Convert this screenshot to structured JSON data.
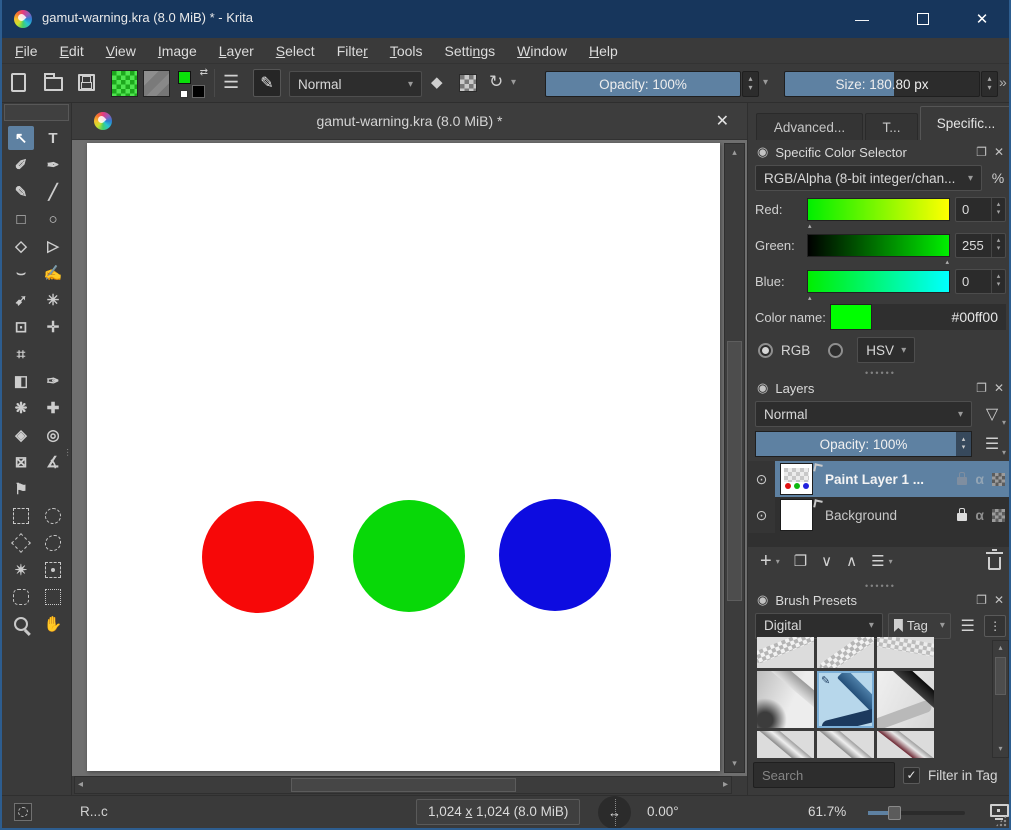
{
  "window": {
    "title": "gamut-warning.kra (8.0 MiB) * - Krita"
  },
  "icons": {
    "window_min": "—",
    "window_close": "✕",
    "docker_lock": "◉",
    "docker_float": "❐",
    "docker_close": "✕",
    "dropdown_arrow": "▾",
    "filter_funnel": "▽",
    "hamburger": "☰",
    "eye": "⊙",
    "swap": "⇄",
    "presets_list": "☰",
    "brush_editor": "✎",
    "eraser": "◆",
    "reload": "↻",
    "overflow_chevron": "»",
    "up_arrow": "▴",
    "down_arrow": "▾",
    "left_arrow": "◂",
    "right_arrow": "▸",
    "add": "+",
    "duplicate": "❐",
    "move_down": "∨",
    "move_up": "∧",
    "properties": "☰",
    "detail_dots": "⋮",
    "check": "✓",
    "percent": "%"
  },
  "menu": {
    "items": [
      {
        "name": "menu-file",
        "pre": "",
        "key": "F",
        "post": "ile"
      },
      {
        "name": "menu-edit",
        "pre": "",
        "key": "E",
        "post": "dit"
      },
      {
        "name": "menu-view",
        "pre": "",
        "key": "V",
        "post": "iew"
      },
      {
        "name": "menu-image",
        "pre": "",
        "key": "I",
        "post": "mage"
      },
      {
        "name": "menu-layer",
        "pre": "",
        "key": "L",
        "post": "ayer"
      },
      {
        "name": "menu-select",
        "pre": "",
        "key": "S",
        "post": "elect"
      },
      {
        "name": "menu-filter",
        "pre": "Filte",
        "key": "r",
        "post": ""
      },
      {
        "name": "menu-tools",
        "pre": "",
        "key": "T",
        "post": "ools"
      },
      {
        "name": "menu-settings",
        "pre": "Setti",
        "key": "n",
        "post": "gs"
      },
      {
        "name": "menu-window",
        "pre": "",
        "key": "W",
        "post": "indow"
      },
      {
        "name": "menu-help",
        "pre": "",
        "key": "H",
        "post": "elp"
      }
    ]
  },
  "toolbar": {
    "blending_mode": "Normal",
    "opacity": "Opacity: 100%",
    "size": "Size: 180.80 px",
    "size_fill_style": "width:56%",
    "fg_style": "background:#0ae00a"
  },
  "toolbox": {
    "tools": [
      {
        "name": "transform-select-tool",
        "g": "↖",
        "cls": "sel"
      },
      {
        "name": "text-tool",
        "g": "T",
        "cls": ""
      },
      {
        "name": "edit-shapes-tool",
        "g": "✐",
        "cls": ""
      },
      {
        "name": "calligraphy-tool",
        "g": "✒",
        "cls": ""
      },
      {
        "name": "freehand-brush-tool",
        "g": "✎",
        "cls": ""
      },
      {
        "name": "line-tool",
        "g": "╱",
        "cls": ""
      },
      {
        "name": "rectangle-tool",
        "g": "□",
        "cls": ""
      },
      {
        "name": "ellipse-tool",
        "g": "○",
        "cls": ""
      },
      {
        "name": "polygon-tool",
        "g": "◇",
        "cls": ""
      },
      {
        "name": "polyline-tool",
        "g": "▷",
        "cls": ""
      },
      {
        "name": "bezier-curve-tool",
        "g": "⌣",
        "cls": ""
      },
      {
        "name": "freehand-path-tool",
        "g": "✍",
        "cls": ""
      },
      {
        "name": "dynamic-brush-tool",
        "g": "➹",
        "cls": ""
      },
      {
        "name": "multibrush-tool",
        "g": "✳",
        "cls": ""
      },
      {
        "name": "transform-tool",
        "g": "⊡",
        "cls": ""
      },
      {
        "name": "move-tool",
        "g": "✛",
        "cls": ""
      },
      {
        "name": "crop-tool",
        "g": "⌗",
        "cls": ""
      },
      {
        "name": "",
        "g": "",
        "cls": "blank"
      },
      {
        "name": "gradient-tool",
        "g": "◧",
        "cls": ""
      },
      {
        "name": "color-sampler-tool",
        "g": "✑",
        "cls": ""
      },
      {
        "name": "patterns-tool",
        "g": "❋",
        "cls": ""
      },
      {
        "name": "smart-patch-tool",
        "g": "✚",
        "cls": ""
      },
      {
        "name": "fill-tool",
        "g": "◈",
        "cls": ""
      },
      {
        "name": "enclose-fill-tool",
        "g": "◎",
        "cls": ""
      },
      {
        "name": "assistants-tool",
        "g": "⊠",
        "cls": ""
      },
      {
        "name": "measure-tool",
        "g": "∡",
        "cls": ""
      },
      {
        "name": "reference-images-tool",
        "g": "⚑",
        "cls": ""
      },
      {
        "name": "",
        "g": "",
        "cls": "blank"
      },
      {
        "name": "rectangular-select-tool",
        "g": "",
        "cls": "shape sq"
      },
      {
        "name": "elliptical-select-tool",
        "g": "",
        "cls": "shape ci"
      },
      {
        "name": "polygonal-select-tool",
        "g": "",
        "cls": "shape po"
      },
      {
        "name": "freehand-select-tool",
        "g": "",
        "cls": "shape fr"
      },
      {
        "name": "contiguous-select-tool",
        "g": "✴",
        "cls": ""
      },
      {
        "name": "similar-color-select-tool",
        "g": "",
        "cls": "shape dot"
      },
      {
        "name": "bezier-select-tool",
        "g": "",
        "cls": "shape bz"
      },
      {
        "name": "magnetic-select-tool",
        "g": "",
        "cls": "shape mg"
      },
      {
        "name": "zoom-tool",
        "g": "",
        "cls": "shape mag"
      },
      {
        "name": "pan-tool",
        "g": "✋",
        "cls": ""
      }
    ]
  },
  "doc": {
    "tab_title": "gamut-warning.kra (8.0 MiB) *"
  },
  "canvas": {
    "circles": [
      {
        "name": "red-circle",
        "color": "#f70808",
        "style": "left:115px;top:358px;width:112px;height:112px;background:#f70808"
      },
      {
        "name": "green-circle",
        "color": "#08d808",
        "style": "left:266px;top:357px;width:112px;height:112px;background:#08d808"
      },
      {
        "name": "blue-circle",
        "color": "#0d0ce0",
        "style": "left:412px;top:356px;width:112px;height:112px;background:#0d0ce0"
      }
    ]
  },
  "docker_tabs": [
    {
      "name": "tab-advanced-color-selector",
      "label": "Advanced...",
      "cls": ""
    },
    {
      "name": "tab-t",
      "label": "T...",
      "cls": ""
    },
    {
      "name": "tab-specific-color-selector",
      "label": "Specific...",
      "cls": "active"
    }
  ],
  "color_selector": {
    "title": "Specific Color Selector",
    "model": "RGB/Alpha (8-bit integer/chan...",
    "channels": [
      {
        "label": "Red:",
        "value": "0",
        "grad": "background:linear-gradient(to right,#00ef00,#ffff00)"
      },
      {
        "label": "Green:",
        "value": "255",
        "grad": "background:linear-gradient(to right,#000000,#00ef00)"
      },
      {
        "label": "Blue:",
        "value": "0",
        "grad": "background:linear-gradient(to right,#00ef00,#00ffff)"
      }
    ],
    "color_name_label": "Color name:",
    "swatch_style": "background:#00ff00",
    "hex": "#00ff00",
    "rgb_label": "RGB",
    "hsv_label": "HSV"
  },
  "layers": {
    "title": "Layers",
    "blending_mode": "Normal",
    "opacity": "Opacity:  100%",
    "alpha": "α",
    "rows": [
      {
        "name": "Paint Layer 1 ..."
      },
      {
        "name": "Background"
      }
    ]
  },
  "brushes": {
    "title": "Brush Presets",
    "tag_filter": "Digital",
    "tag_button": "Tag",
    "search_placeholder": "Search",
    "filter_label": "Filter in Tag",
    "filter_checked": true,
    "tiles": [
      {
        "name": "brush-preset-eraser-circle",
        "cls": "er1"
      },
      {
        "name": "brush-preset-eraser-small",
        "cls": "er2"
      },
      {
        "name": "brush-preset-eraser-soft",
        "cls": "er3"
      },
      {
        "name": "brush-preset-airbrush",
        "cls": "air"
      },
      {
        "name": "brush-preset-pencil-2b",
        "cls": "pencil sel"
      },
      {
        "name": "brush-preset-ink-gpen",
        "cls": "ink"
      },
      {
        "name": "brush-preset-pen-1",
        "cls": "pen1"
      },
      {
        "name": "brush-preset-pen-2",
        "cls": "pen2"
      },
      {
        "name": "brush-preset-pen-3",
        "cls": "pen3"
      }
    ]
  },
  "status": {
    "left": "R...c",
    "dims_pre": "1,024 ",
    "dims_x": "x",
    "dims_post": " 1,024 (8.0 MiB)",
    "angle": "0.00°",
    "zoom_pct": "61.7%"
  },
  "colors": {
    "accent_blue": "#5e81a2",
    "titlebar": "#17365c",
    "panel": "#3a3a3a",
    "canvas_desk": "#6f6f6f"
  }
}
